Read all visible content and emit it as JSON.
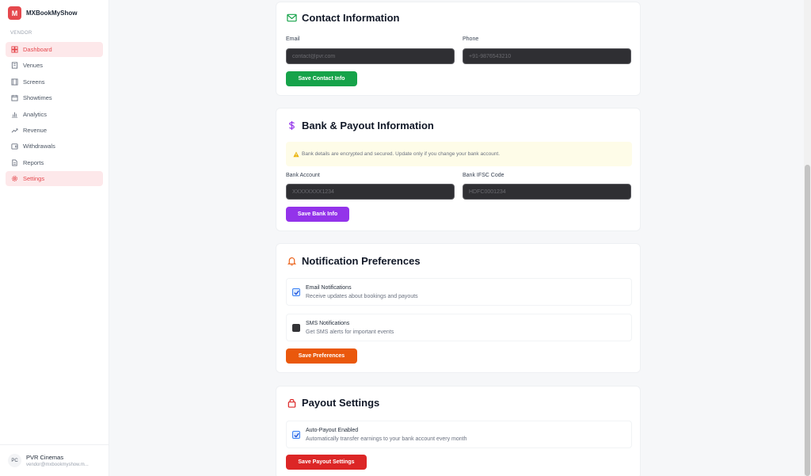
{
  "brand": {
    "logo_letter": "M",
    "name": "MXBookMyShow",
    "accent": "#e5484d"
  },
  "sidebar": {
    "section_label": "VENDOR",
    "items": [
      {
        "label": "Dashboard",
        "icon": "dashboard-icon",
        "active": true
      },
      {
        "label": "Venues",
        "icon": "building-icon"
      },
      {
        "label": "Screens",
        "icon": "film-icon"
      },
      {
        "label": "Showtimes",
        "icon": "calendar-icon"
      },
      {
        "label": "Analytics",
        "icon": "bar-chart-icon"
      },
      {
        "label": "Revenue",
        "icon": "trending-up-icon"
      },
      {
        "label": "Withdrawals",
        "icon": "wallet-icon"
      },
      {
        "label": "Reports",
        "icon": "file-icon"
      },
      {
        "label": "Settings",
        "icon": "gear-icon",
        "active": true
      }
    ]
  },
  "user": {
    "initials": "PC",
    "name": "PVR Cinemas",
    "email": "vendor@mxbookmyshow.m..."
  },
  "contact": {
    "title": "Contact Information",
    "icon": "mail-icon",
    "email_label": "Email",
    "email_placeholder": "contact@pvr.com",
    "phone_label": "Phone",
    "phone_placeholder": "+91-9876543210",
    "save_label": "Save Contact Info"
  },
  "bank": {
    "title": "Bank & Payout Information",
    "icon": "dollar-icon",
    "notice": "Bank details are encrypted and secured. Update only if you change your bank account.",
    "account_label": "Bank Account",
    "account_placeholder": "XXXXXXXX1234",
    "ifsc_label": "Bank IFSC Code",
    "ifsc_placeholder": "HDFC0001234",
    "save_label": "Save Bank Info"
  },
  "notifications": {
    "title": "Notification Preferences",
    "icon": "bell-icon",
    "email": {
      "title": "Email Notifications",
      "desc": "Receive updates about bookings and payouts",
      "checked": true
    },
    "sms": {
      "title": "SMS Notifications",
      "desc": "Get SMS alerts for important events",
      "checked": false
    },
    "save_label": "Save Preferences"
  },
  "payout": {
    "title": "Payout Settings",
    "icon": "lock-icon",
    "auto": {
      "title": "Auto-Payout Enabled",
      "desc": "Automatically transfer earnings to your bank account every month",
      "checked": true
    },
    "save_label": "Save Payout Settings"
  },
  "colors": {
    "green": "#16a34a",
    "purple": "#9333ea",
    "orange": "#ea580c",
    "red": "#dc2626"
  }
}
